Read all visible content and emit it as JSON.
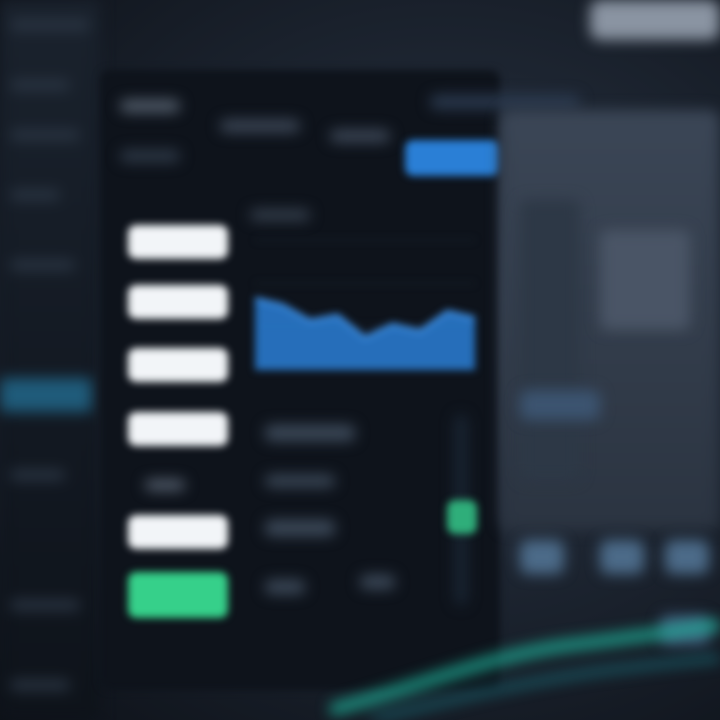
{
  "colors": {
    "accent_blue": "#2a7fd6",
    "accent_green": "#36d08a",
    "accent_teal": "#1fb39b",
    "panel_bg": "#0e131b",
    "button_white": "#f2f5f8"
  },
  "sidebar": {
    "items": [
      {
        "label": ""
      },
      {
        "label": ""
      },
      {
        "label": ""
      },
      {
        "label": ""
      },
      {
        "label": ""
      }
    ]
  },
  "header": {
    "tabs": [
      {
        "label": ""
      },
      {
        "label": ""
      },
      {
        "label": ""
      },
      {
        "label": ""
      }
    ]
  },
  "buttons": [
    {
      "label": ""
    },
    {
      "label": ""
    },
    {
      "label": ""
    },
    {
      "label": ""
    },
    {
      "label": ""
    }
  ],
  "primary_action": {
    "label": ""
  },
  "chart_data": {
    "type": "area",
    "x": [
      0,
      1,
      2,
      3,
      4,
      5,
      6,
      7,
      8
    ],
    "series": [
      {
        "values": [
          0.55,
          0.5,
          0.38,
          0.42,
          0.25,
          0.35,
          0.3,
          0.45,
          0.4
        ]
      }
    ],
    "ylim": [
      0,
      1
    ]
  }
}
